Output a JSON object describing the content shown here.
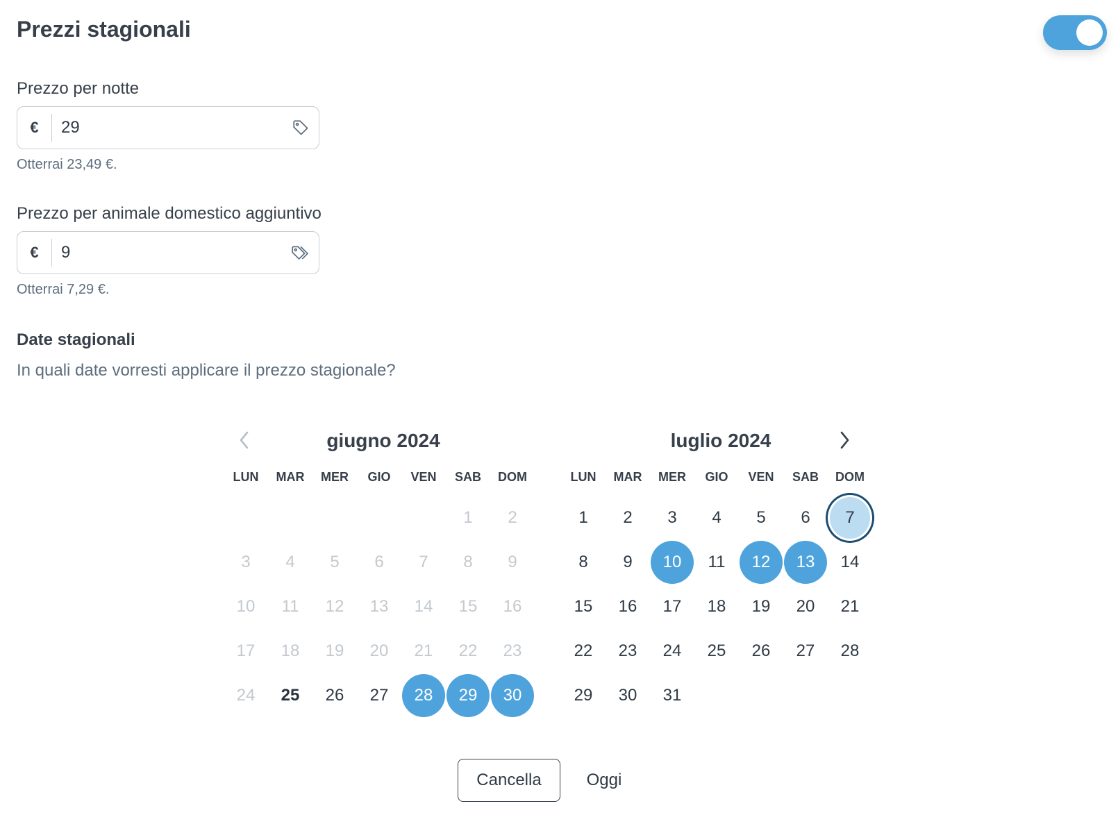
{
  "header": {
    "title": "Prezzi stagionali",
    "toggle_on": true
  },
  "price_night": {
    "label": "Prezzo per notte",
    "currency": "€",
    "value": "29",
    "hint": "Otterrai 23,49 €."
  },
  "price_pet": {
    "label": "Prezzo per animale domestico aggiuntivo",
    "currency": "€",
    "value": "9",
    "hint": "Otterrai 7,29 €."
  },
  "dates": {
    "title": "Date stagionali",
    "subtitle": "In quali date vorresti applicare il prezzo stagionale?"
  },
  "calendar": {
    "weekdays": [
      "LUN",
      "MAR",
      "MER",
      "GIO",
      "VEN",
      "SAB",
      "DOM"
    ],
    "months": [
      {
        "title": "giugno 2024",
        "offset": 5,
        "days": 30,
        "disabled_until": 24,
        "today": 25,
        "selected": [
          28,
          29,
          30
        ],
        "focused": null
      },
      {
        "title": "luglio 2024",
        "offset": 0,
        "days": 31,
        "disabled_until": 0,
        "today": null,
        "selected": [
          10,
          12,
          13
        ],
        "focused": 7
      }
    ]
  },
  "footer": {
    "cancel_label": "Cancella",
    "today_label": "Oggi"
  },
  "colors": {
    "accent": "#4ea3dd",
    "focus_ring": "#1b4d72",
    "focus_fill": "#bcdcf2"
  },
  "icons": {
    "prev": "chevron-left-icon",
    "next": "chevron-right-icon",
    "price_tag": "tag-icon",
    "pet_tags": "tags-icon"
  }
}
